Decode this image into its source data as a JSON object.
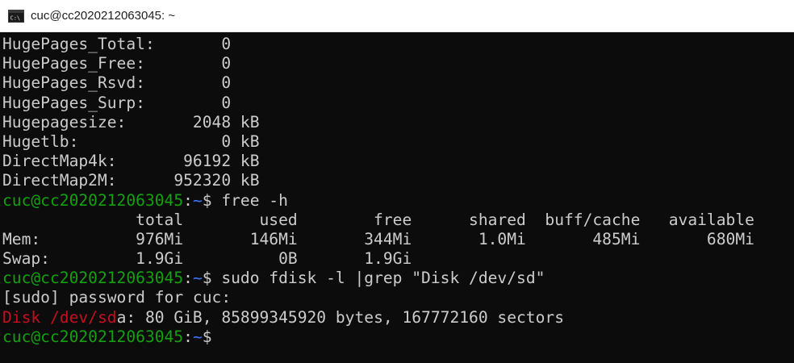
{
  "window": {
    "title": "cuc@cc2020212063045: ~",
    "icon": "terminal-icon"
  },
  "colors": {
    "background": "#0c0c0c",
    "foreground": "#cccccc",
    "prompt_user": "#13a10e",
    "prompt_path": "#3b78ff",
    "match_highlight": "#c50f1f"
  },
  "terminal": {
    "meminfo_lines": [
      "HugePages_Total:       0",
      "HugePages_Free:        0",
      "HugePages_Rsvd:        0",
      "HugePages_Surp:        0",
      "Hugepagesize:       2048 kB",
      "Hugetlb:               0 kB",
      "DirectMap4k:       96192 kB",
      "DirectMap2M:      952320 kB"
    ],
    "prompt_user": "cuc@cc2020212063045",
    "prompt_sep": ":",
    "prompt_path": "~",
    "prompt_symbol": "$ ",
    "cmd_free": "free -h",
    "free_header": "              total        used        free      shared  buff/cache   available",
    "free_mem": "Mem:          976Mi       146Mi       344Mi       1.0Mi       485Mi       680Mi",
    "free_swap": "Swap:         1.9Gi          0B       1.9Gi",
    "cmd_fdisk": "sudo fdisk -l |grep \"Disk /dev/sd\"",
    "sudo_prompt": "[sudo] password for cuc:",
    "disk_match": "Disk /dev/sd",
    "disk_rest": "a: 80 GiB, 85899345920 bytes, 167772160 sectors"
  }
}
